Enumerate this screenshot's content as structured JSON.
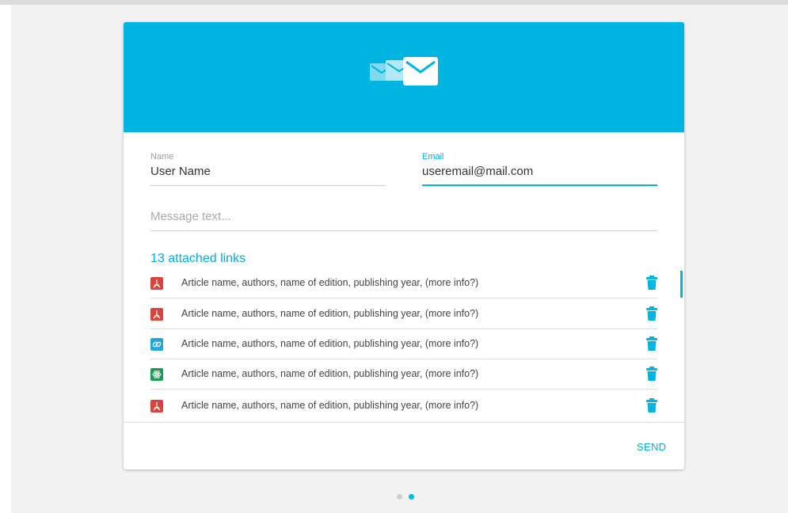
{
  "form": {
    "name_label": "Name",
    "name_value": "User Name",
    "email_label": "Email",
    "email_value": "useremail@mail.com",
    "message_placeholder": "Message text..."
  },
  "attachments": {
    "title": "13 attached links",
    "items": [
      {
        "type": "pdf-icon",
        "text": "Article name, authors, name of edition, publishing year, (more info?)"
      },
      {
        "type": "pdf-icon",
        "text": "Article name, authors, name of edition, publishing year, (more info?)"
      },
      {
        "type": "link-icon",
        "text": "Article name, authors, name of edition, publishing year, (more info?)"
      },
      {
        "type": "atom-icon",
        "text": "Article name, authors, name of edition, publishing year, (more info?)"
      },
      {
        "type": "pdf-icon",
        "text": "Article name, authors, name of edition, publishing year, (more info?)"
      }
    ]
  },
  "actions": {
    "send_label": "SEND"
  },
  "pagination": {
    "total": 2,
    "active_index": 1
  },
  "colors": {
    "accent": "#00b5e2",
    "pdf": "#d9443a",
    "link": "#21a7e0",
    "atom": "#1e9a57"
  }
}
